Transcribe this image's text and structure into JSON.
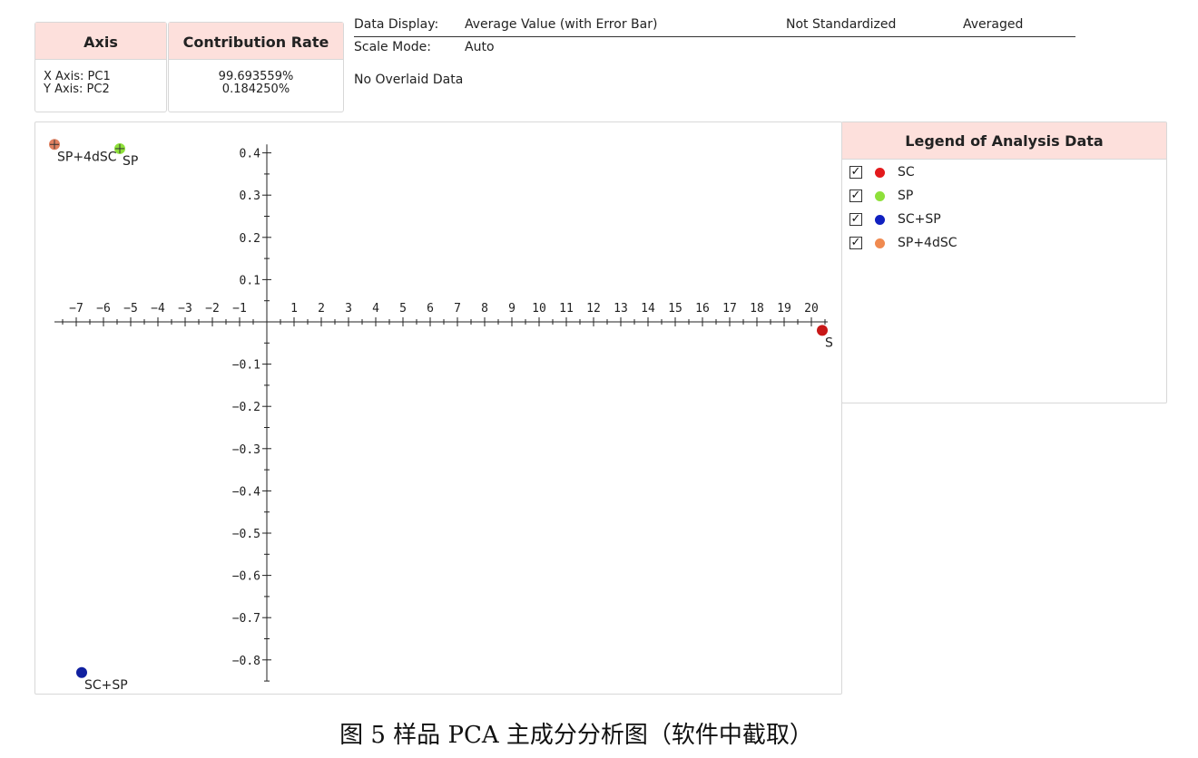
{
  "axis_panel": {
    "header": "Axis",
    "x_axis": "X Axis: PC1",
    "y_axis": "Y Axis: PC2"
  },
  "contribution_panel": {
    "header": "Contribution Rate",
    "pc1": "99.693559%",
    "pc2": "0.184250%"
  },
  "info": {
    "data_display_label": "Data Display:",
    "data_display_value": "Average Value (with Error Bar)",
    "standardization": "Not Standardized",
    "averaging": "Averaged",
    "scale_mode_label": "Scale Mode:",
    "scale_mode_value": "Auto",
    "overlay": "No Overlaid Data"
  },
  "legend": {
    "header": "Legend of Analysis Data",
    "items": [
      {
        "label": "SC",
        "color": "#e31a1c",
        "checked": true
      },
      {
        "label": "SP",
        "color": "#8ee03a",
        "checked": true
      },
      {
        "label": "SC+SP",
        "color": "#1020c0",
        "checked": true
      },
      {
        "label": "SP+4dSC",
        "color": "#f08a50",
        "checked": true
      }
    ]
  },
  "chart_data": {
    "type": "scatter",
    "xlabel": "",
    "ylabel": "",
    "xlim": [
      -7.8,
      21
    ],
    "ylim": [
      -0.85,
      0.42
    ],
    "x_ticks": [
      -7,
      -6,
      -5,
      -4,
      -3,
      -2,
      -1,
      1,
      2,
      3,
      4,
      5,
      6,
      7,
      8,
      9,
      10,
      11,
      12,
      13,
      14,
      15,
      16,
      17,
      18,
      19,
      20
    ],
    "y_ticks": [
      "0.4",
      "0.3",
      "0.2",
      "0.1",
      "-0.1",
      "-0.2",
      "-0.3",
      "-0.4",
      "-0.5",
      "-0.6",
      "-0.7",
      "-0.8"
    ],
    "y_tick_values": [
      0.4,
      0.3,
      0.2,
      0.1,
      -0.1,
      -0.2,
      -0.3,
      -0.4,
      -0.5,
      -0.6,
      -0.7,
      -0.8
    ],
    "points": [
      {
        "name": "SC",
        "label": "S",
        "x": 20.4,
        "y": -0.02,
        "color": "#c81818"
      },
      {
        "name": "SP",
        "label": "SP",
        "x": -5.4,
        "y": 0.41,
        "color": "#8ee03a"
      },
      {
        "name": "SC+SP",
        "label": "SC+SP",
        "x": -6.8,
        "y": -0.83,
        "color": "#1020a0"
      },
      {
        "name": "SP+4dSC",
        "label": "SP+4dSC",
        "x": -7.8,
        "y": 0.42,
        "color": "#e08060"
      }
    ]
  },
  "caption": "图 5 样品 PCA 主成分分析图（软件中截取）"
}
